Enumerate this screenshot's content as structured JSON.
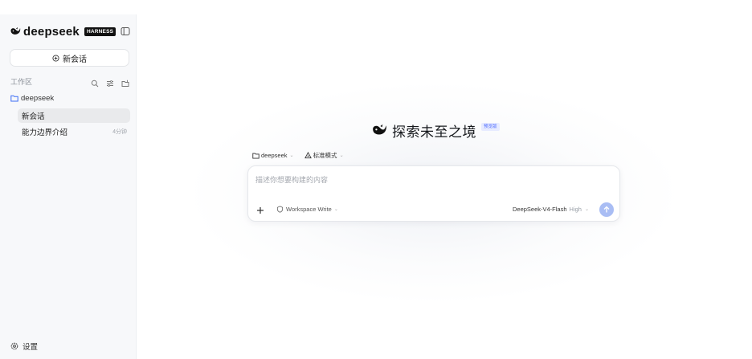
{
  "sidebar": {
    "brand_name": "deepseek",
    "brand_badge": "HARNESS",
    "new_chat_label": "新会话",
    "workspace_label": "工作区",
    "folder_name": "deepseek",
    "chats": [
      {
        "title": "新会话",
        "time": "",
        "active": true
      },
      {
        "title": "能力边界介绍",
        "time": "4分钟",
        "active": false
      }
    ],
    "settings_label": "设置"
  },
  "main": {
    "hero_title": "探索未至之境",
    "hero_badge": "预览版",
    "context": {
      "folder": "deepseek",
      "mode": "标准模式"
    },
    "composer": {
      "placeholder": "描述你想要构建的内容",
      "permission": "Workspace Write",
      "model_name": "DeepSeek-V4-Flash",
      "model_level": "High"
    }
  },
  "icons": {
    "brand": "whale-logo-icon",
    "collapse": "sidebar-toggle-icon",
    "new_chat": "plus-circle-icon",
    "search": "search-icon",
    "filter": "filter-icon",
    "new_folder": "new-folder-icon",
    "folder": "folder-icon",
    "settings": "gear-icon",
    "mode": "mode-icon",
    "permission": "shield-icon",
    "plus": "plus-icon",
    "send": "arrow-up-icon"
  },
  "colors": {
    "accent": "#4d6bff",
    "send_button": "#a9bdf4",
    "sidebar_bg": "#f7f8fa",
    "active_item_bg": "#e9eaec"
  }
}
